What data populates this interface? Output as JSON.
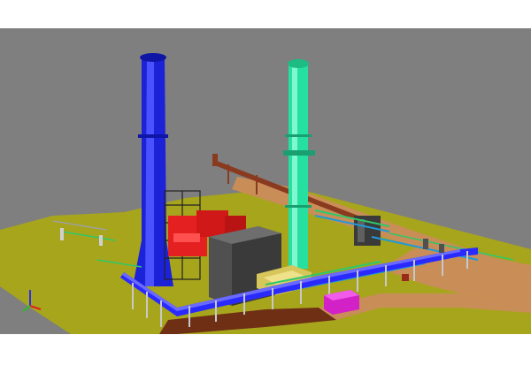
{
  "viewport": {
    "background_color": "#7f7f7f",
    "page_background": "#ffffff"
  },
  "scene": {
    "title": "",
    "ground_color": "#a7a51c",
    "road_color": "#c98d57",
    "objects": [
      {
        "name": "blue-stack",
        "color": "#1c22d8"
      },
      {
        "name": "green-stack",
        "color": "#25e0a0"
      },
      {
        "name": "boiler-structure",
        "color": "#505050"
      },
      {
        "name": "red-equipment",
        "color": "#e52020"
      },
      {
        "name": "main-pipe-rack",
        "color": "#2a2aff"
      },
      {
        "name": "brown-pipe",
        "color": "#7a2e1a"
      },
      {
        "name": "magenta-skid",
        "color": "#d321c8"
      },
      {
        "name": "yellow-duct",
        "color": "#d7c65a"
      },
      {
        "name": "axis-triad",
        "color": "#2d2df0"
      }
    ]
  }
}
